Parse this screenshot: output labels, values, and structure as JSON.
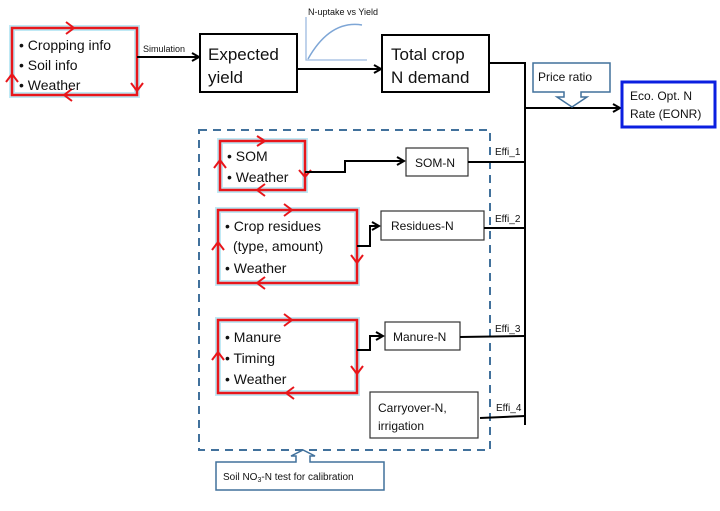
{
  "inputs": {
    "items": [
      "• Cropping info",
      "• Soil info",
      "• Weather"
    ]
  },
  "simulation_label": "Simulation",
  "expected_yield": {
    "line1": "Expected",
    "line2": "yield"
  },
  "mini_chart": {
    "title": "N-uptake vs Yield"
  },
  "total_demand": {
    "line1": "Total crop",
    "line2": "N demand"
  },
  "price_ratio": "Price ratio",
  "eonr": {
    "line1": "Eco. Opt. N",
    "line2": "Rate (EONR)"
  },
  "som": {
    "items": [
      "• SOM",
      "• Weather"
    ],
    "output": "SOM-N",
    "effi": "Effi_1"
  },
  "residues": {
    "items": [
      "• Crop residues",
      "(type, amount)",
      "• Weather"
    ],
    "output": "Residues-N",
    "effi": "Effi_2"
  },
  "manure": {
    "items": [
      "• Manure",
      "• Timing",
      "• Weather"
    ],
    "output": "Manure-N",
    "effi": "Effi_3"
  },
  "carryover": {
    "line1": "Carryover-N,",
    "line2": "irrigation",
    "effi": "Effi_4"
  },
  "soil_test": {
    "prefix": "Soil NO",
    "sub": "3",
    "suffix": "-N test for calibration"
  },
  "colors": {
    "cycle_red": "#e8161b",
    "eonr_blue": "#0b1fe0",
    "callout_blue": "#41719c"
  }
}
